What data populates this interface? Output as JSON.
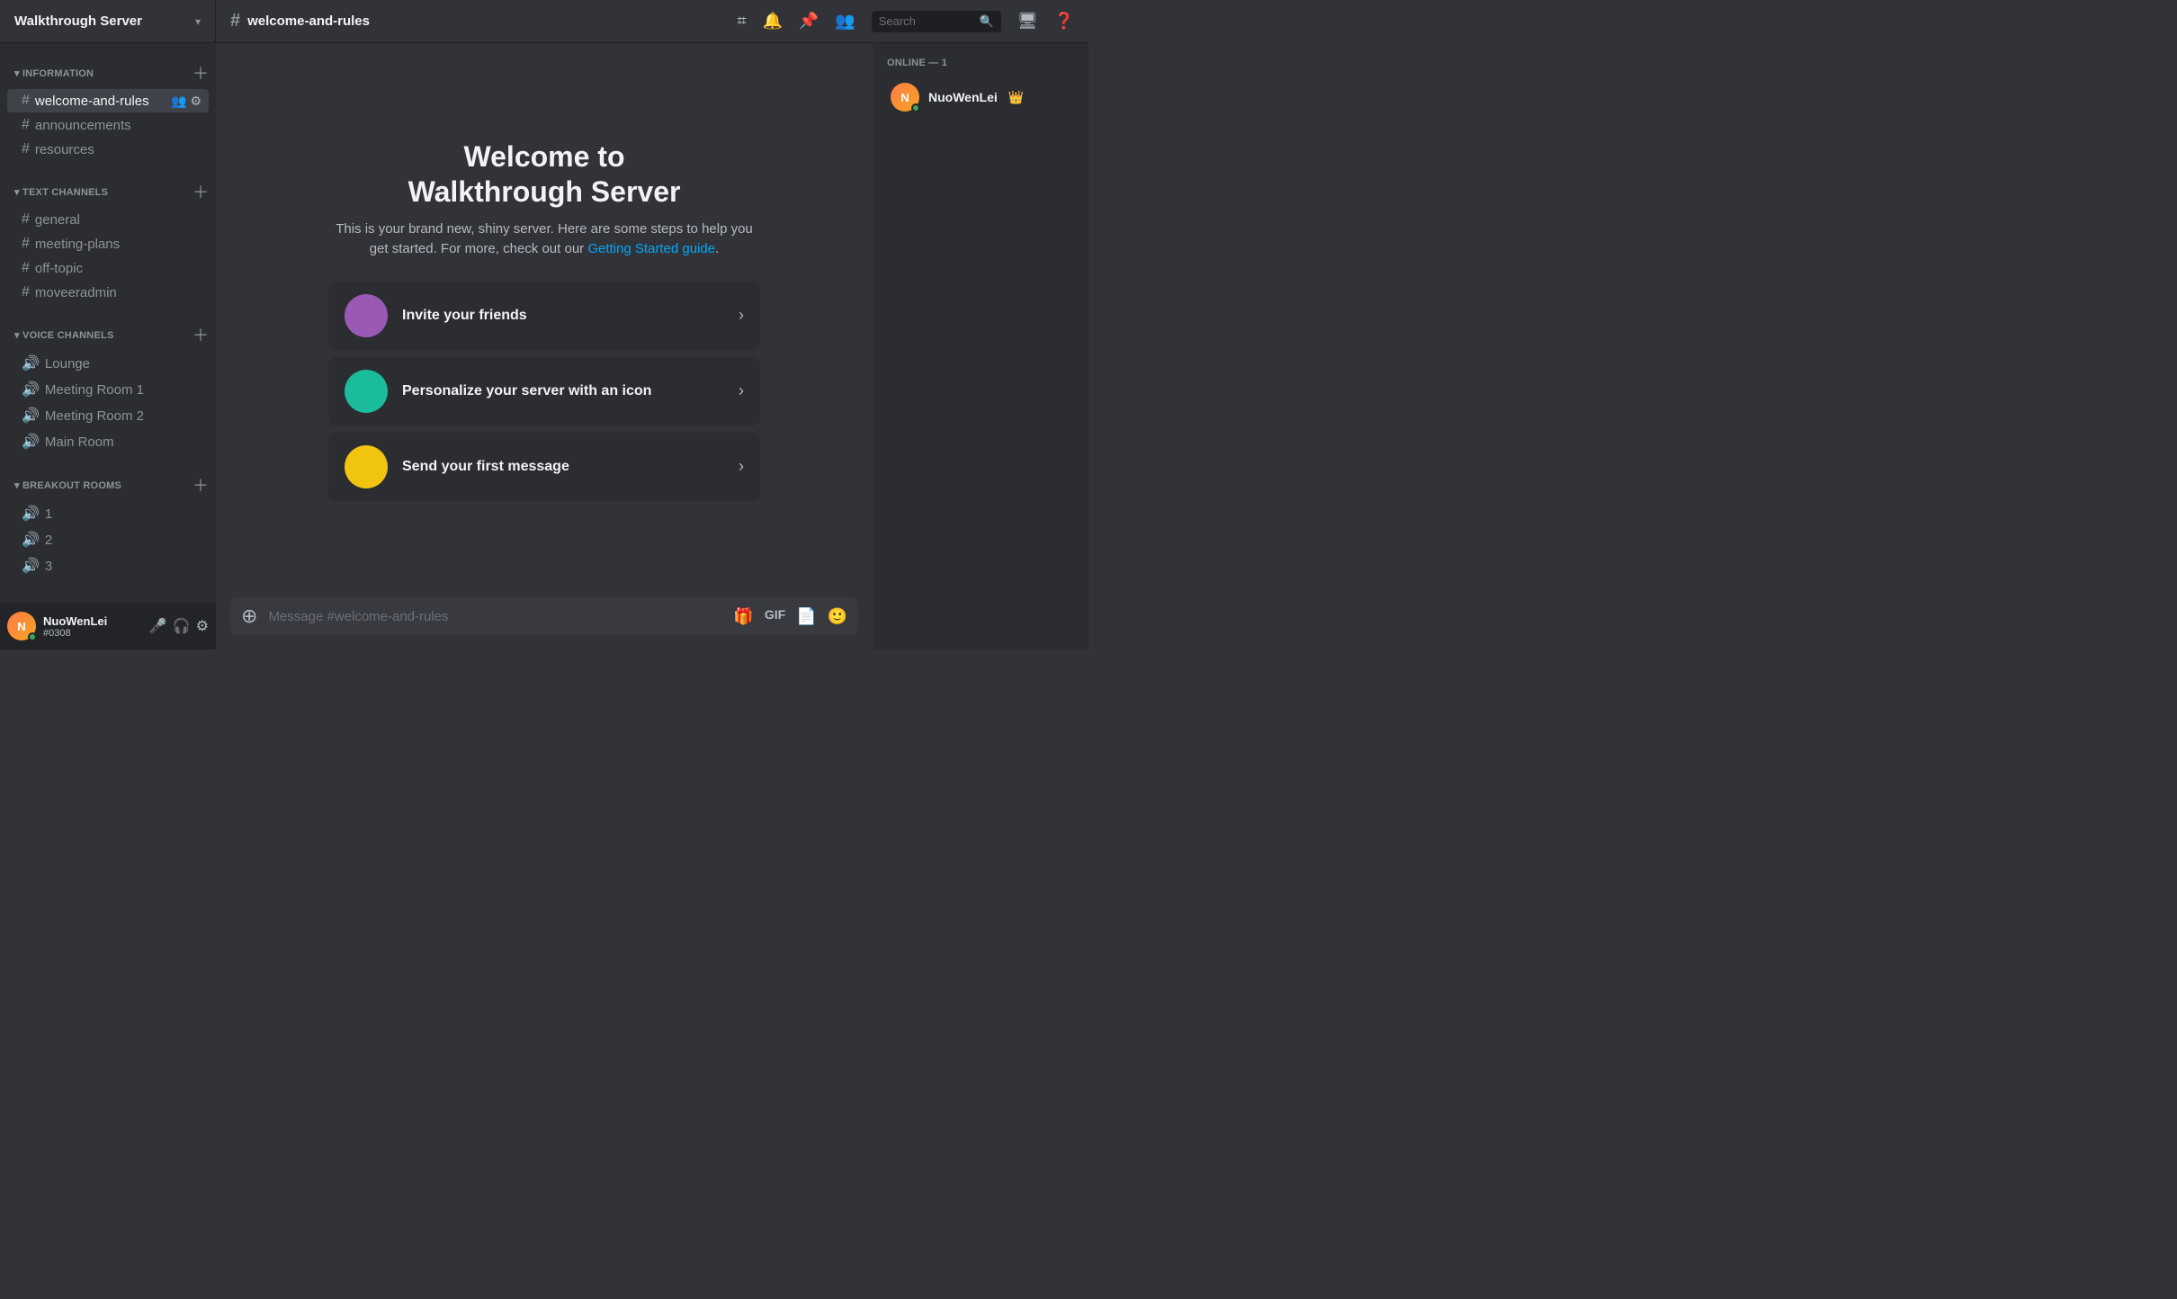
{
  "topbar": {
    "server_name": "Walkthrough Server",
    "channel_name": "welcome-and-rules",
    "search_placeholder": "Search"
  },
  "sidebar": {
    "sections": [
      {
        "id": "information",
        "title": "Information",
        "channels": [
          {
            "id": "welcome-and-rules",
            "name": "welcome-and-rules",
            "type": "text",
            "active": true
          },
          {
            "id": "announcements",
            "name": "announcements",
            "type": "text",
            "active": false
          },
          {
            "id": "resources",
            "name": "resources",
            "type": "text",
            "active": false
          }
        ]
      },
      {
        "id": "text-channels",
        "title": "Text Channels",
        "channels": [
          {
            "id": "general",
            "name": "general",
            "type": "text",
            "active": false
          },
          {
            "id": "meeting-plans",
            "name": "meeting-plans",
            "type": "text",
            "active": false
          },
          {
            "id": "off-topic",
            "name": "off-topic",
            "type": "text",
            "active": false
          },
          {
            "id": "moveeradmin",
            "name": "moveeradmin",
            "type": "text",
            "active": false
          }
        ]
      },
      {
        "id": "voice-channels",
        "title": "Voice Channels",
        "channels": [
          {
            "id": "lounge",
            "name": "Lounge",
            "type": "voice",
            "active": false
          },
          {
            "id": "meeting-room-1",
            "name": "Meeting Room 1",
            "type": "voice",
            "active": false
          },
          {
            "id": "meeting-room-2",
            "name": "Meeting Room 2",
            "type": "voice",
            "active": false
          },
          {
            "id": "main-room",
            "name": "Main Room",
            "type": "voice",
            "active": false
          }
        ]
      },
      {
        "id": "breakout-rooms",
        "title": "Breakout Rooms",
        "channels": [
          {
            "id": "br-1",
            "name": "1",
            "type": "voice",
            "active": false
          },
          {
            "id": "br-2",
            "name": "2",
            "type": "voice",
            "active": false
          },
          {
            "id": "br-3",
            "name": "3",
            "type": "voice",
            "active": false
          }
        ]
      }
    ],
    "user": {
      "name": "NuoWenLei",
      "tag": "#0308"
    }
  },
  "welcome": {
    "title": "Welcome to\nWalkthrough Server",
    "description": "This is your brand new, shiny server. Here are some steps to help you get started. For more, check out our",
    "link_text": "Getting Started guide",
    "action_cards": [
      {
        "id": "invite",
        "label": "Invite your friends",
        "icon": "👋",
        "color": "#9b59b6"
      },
      {
        "id": "personalize",
        "label": "Personalize your server with an icon",
        "icon": "🎨",
        "color": "#1abc9c"
      },
      {
        "id": "message",
        "label": "Send your first message",
        "icon": "💬",
        "color": "#f1c40f"
      }
    ]
  },
  "message_input": {
    "placeholder": "Message #welcome-and-rules"
  },
  "right_sidebar": {
    "online_header": "ONLINE — 1",
    "users": [
      {
        "name": "NuoWenLei",
        "is_owner": true
      }
    ]
  }
}
